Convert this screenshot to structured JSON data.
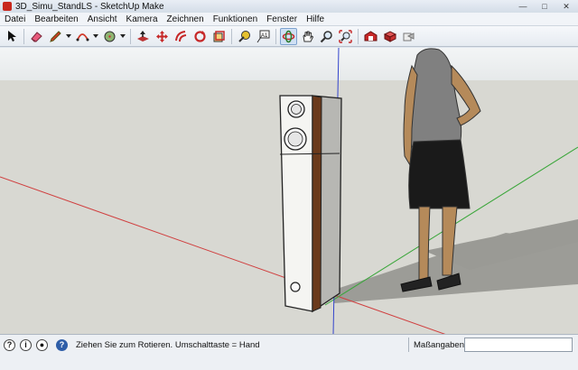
{
  "window": {
    "title": "3D_Simu_StandLS - SketchUp Make"
  },
  "menu": [
    "Datei",
    "Bearbeiten",
    "Ansicht",
    "Kamera",
    "Zeichnen",
    "Funktionen",
    "Fenster",
    "Hilfe"
  ],
  "toolbar": {
    "tools": [
      "select-tool",
      "eraser-tool",
      "pencil-tool",
      "arc-tool",
      "shapes-tool",
      "push-pull-tool",
      "move-tool",
      "offset-tool",
      "rotate-tool",
      "scale-tool",
      "tape-measure-tool",
      "text-tool",
      "orbit-tool",
      "pan-tool",
      "zoom-tool",
      "zoom-extents-tool",
      "3d-warehouse-tool",
      "extension-warehouse-tool",
      "share-model-tool"
    ],
    "active_tool": "orbit-tool"
  },
  "status": {
    "hint": "Ziehen Sie zum Rotieren.  Umschalttaste = Hand",
    "measurements_label": "Maßangaben",
    "measurements_value": ""
  },
  "colors": {
    "red_axis": "#d04040",
    "green_axis": "#3aa63a",
    "blue_axis": "#3344cc",
    "speaker_wood": "#6b3a1c",
    "shirt": "#808080",
    "skirt": "#1a1a1a",
    "skin": "#b58a5a"
  }
}
